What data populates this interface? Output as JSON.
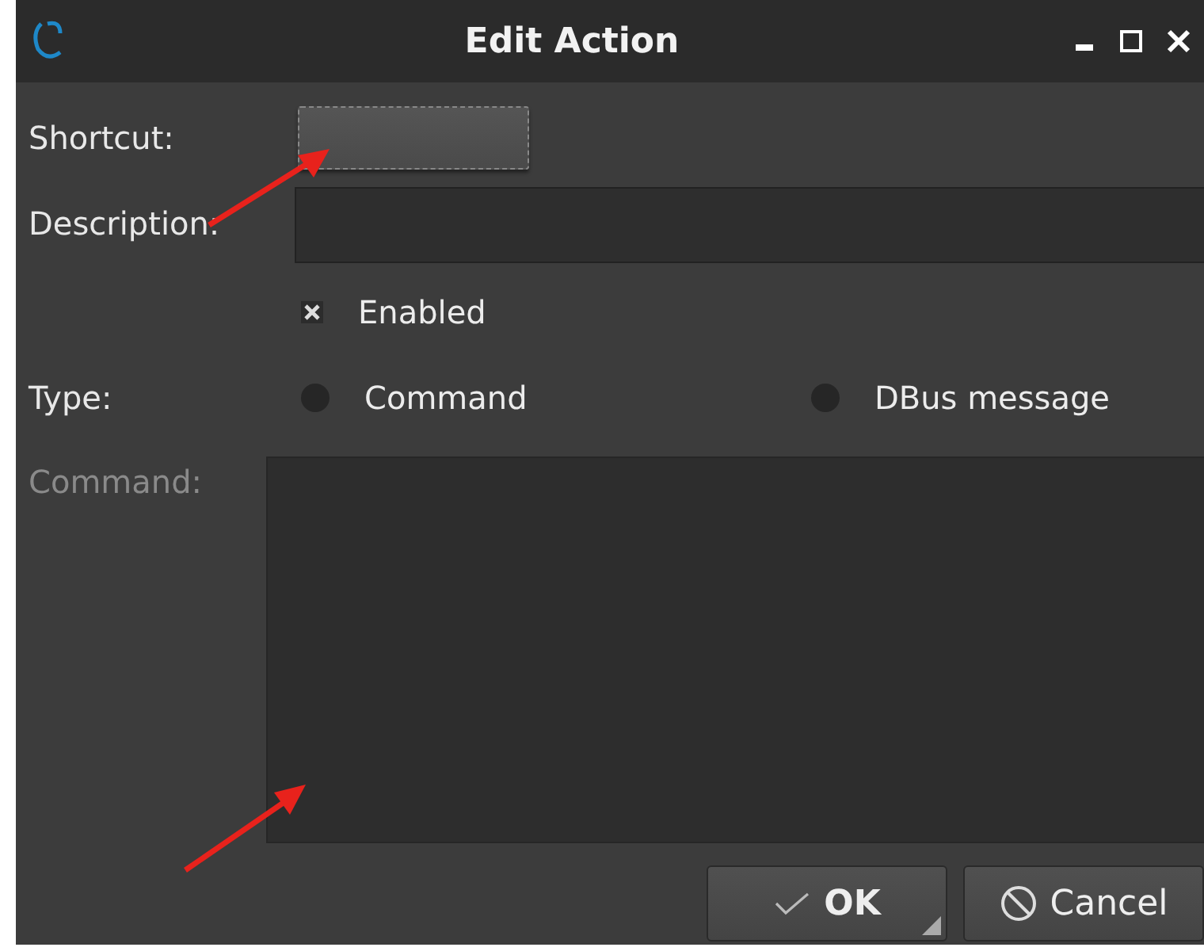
{
  "window": {
    "title": "Edit Action"
  },
  "shortcut": {
    "label": "Shortcut:"
  },
  "description": {
    "label": "Description:"
  },
  "enabled": {
    "label": "Enabled",
    "checked": true
  },
  "type": {
    "label": "Type:",
    "options": [
      {
        "label": "Command",
        "selected": false
      },
      {
        "label": "DBus message",
        "selected": false
      }
    ]
  },
  "command": {
    "label": "Command:",
    "disabled": true
  },
  "buttons": [
    {
      "label": "OK",
      "kind": "ok"
    },
    {
      "label": "Cancel",
      "kind": "cancel"
    }
  ]
}
